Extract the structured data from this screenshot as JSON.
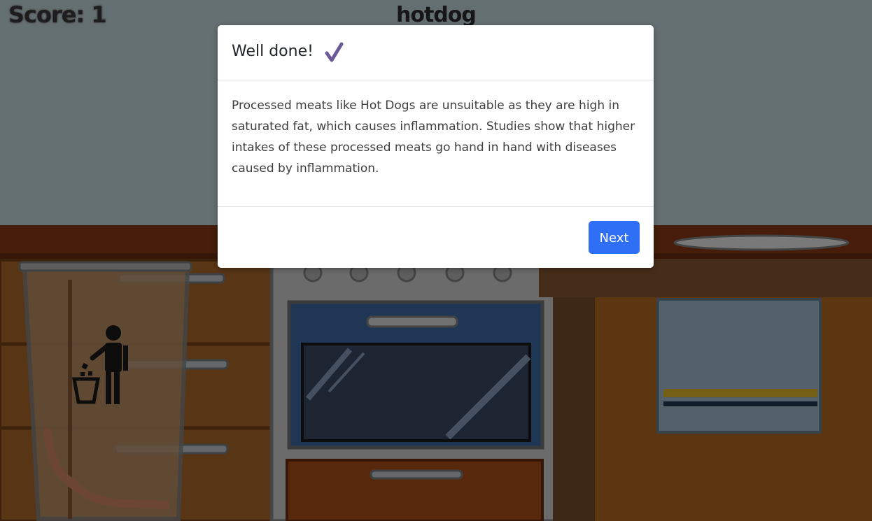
{
  "hud": {
    "score_text": "Score: 1",
    "item_name": "hotdog"
  },
  "modal": {
    "title": "Well done!",
    "title_icon": "checkmark-icon",
    "body": "Processed meats like Hot Dogs are unsuitable as they are high in saturated fat, which causes inflammation. Studies show that higher intakes of these processed meats go hand in hand with diseases caused by inflammation.",
    "next_label": "Next"
  },
  "colors": {
    "accent": "#2f6ff5",
    "check": "#6a5a9a"
  },
  "icons": [
    "trash-bin-icon",
    "person-throwing-trash-icon",
    "checkmark-icon"
  ]
}
